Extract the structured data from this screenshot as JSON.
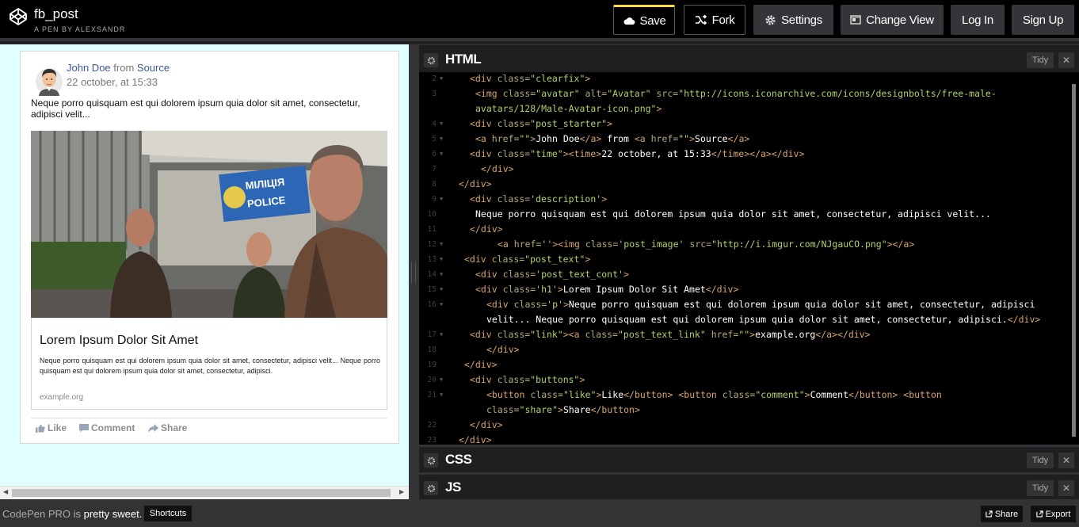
{
  "header": {
    "title": "fb_post",
    "subtitle": "A PEN BY ALEXSANDR",
    "save": "Save",
    "fork": "Fork",
    "settings": "Settings",
    "change_view": "Change View",
    "login": "Log In",
    "signup": "Sign Up",
    "accent_color": "#ffdd40"
  },
  "post": {
    "author": "John Doe",
    "from_text": "from",
    "source": "Source",
    "time": "22 october, at 15:33",
    "description": "Neque porro quisquam est qui dolorem ipsum quia dolor sit amet, consectetur, adipisci velit...",
    "image_sign_1": "МІЛІЦІЯ",
    "image_sign_2": "POLICE",
    "link_title": "Lorem Ipsum Dolor Sit Amet",
    "link_text": "Neque porro quisquam est qui dolorem ipsum quia dolor sit amet, consectetur, adipisci velit... Neque porro quisquam est qui dolorem ipsum quia dolor sit amet, consectetur, adipisci.",
    "link_url": "example.org",
    "like": "Like",
    "comment": "Comment",
    "share": "Share"
  },
  "panels": {
    "html": "HTML",
    "css": "CSS",
    "js": "JS",
    "tidy": "Tidy",
    "close": "✕"
  },
  "code_lines": [
    {
      "n": "2",
      "fold": true,
      "indent": 2,
      "parts": [
        [
          "t",
          "<div "
        ],
        [
          "a",
          "class="
        ],
        [
          "v",
          "\"clearfix\""
        ],
        [
          "t",
          ">"
        ]
      ]
    },
    {
      "n": "3",
      "fold": false,
      "indent": 3,
      "parts": [
        [
          "t",
          "<img "
        ],
        [
          "a",
          "class="
        ],
        [
          "v",
          "\"avatar\" "
        ],
        [
          "a",
          "alt="
        ],
        [
          "v",
          "\"Avatar\" "
        ],
        [
          "a",
          "src="
        ],
        [
          "v",
          "\"http://icons.iconarchive.com/icons/designbolts/free-male-"
        ]
      ]
    },
    {
      "n": "",
      "fold": false,
      "indent": 3,
      "parts": [
        [
          "v",
          "avatars/128/Male-Avatar-icon.png\""
        ],
        [
          "t",
          ">"
        ]
      ]
    },
    {
      "n": "4",
      "fold": true,
      "indent": 2,
      "parts": [
        [
          "t",
          "<div "
        ],
        [
          "a",
          "class="
        ],
        [
          "v",
          "\"post_starter\""
        ],
        [
          "t",
          ">"
        ]
      ]
    },
    {
      "n": "5",
      "fold": true,
      "indent": 3,
      "parts": [
        [
          "t",
          "<a "
        ],
        [
          "a",
          "href="
        ],
        [
          "v",
          "\"\""
        ],
        [
          "t",
          ">"
        ],
        [
          "w",
          "John Doe"
        ],
        [
          "t",
          "</a> "
        ],
        [
          "w",
          "from "
        ],
        [
          "t",
          "<a "
        ],
        [
          "a",
          "href="
        ],
        [
          "v",
          "\"\""
        ],
        [
          "t",
          ">"
        ],
        [
          "w",
          "Source"
        ],
        [
          "t",
          "</a>"
        ]
      ]
    },
    {
      "n": "6",
      "fold": true,
      "indent": 2,
      "parts": [
        [
          "t",
          "<div "
        ],
        [
          "a",
          "class="
        ],
        [
          "v",
          "\"time\""
        ],
        [
          "t",
          ">"
        ],
        [
          "t",
          "<time>"
        ],
        [
          "w",
          "22 october, at 15:33"
        ],
        [
          "t",
          "</time></a></div>"
        ]
      ]
    },
    {
      "n": "7",
      "fold": false,
      "indent": 4,
      "parts": [
        [
          "t",
          "</div>"
        ]
      ]
    },
    {
      "n": "8",
      "fold": false,
      "indent": 0,
      "parts": [
        [
          "t",
          "</div>"
        ]
      ]
    },
    {
      "n": "9",
      "fold": true,
      "indent": 2,
      "parts": [
        [
          "t",
          "<div "
        ],
        [
          "a",
          "class="
        ],
        [
          "v",
          "'description'"
        ],
        [
          "t",
          ">"
        ]
      ]
    },
    {
      "n": "10",
      "fold": false,
      "indent": 3,
      "parts": [
        [
          "w",
          "Neque porro quisquam est qui dolorem ipsum quia dolor sit amet, consectetur, adipisci velit..."
        ]
      ]
    },
    {
      "n": "11",
      "fold": false,
      "indent": 2,
      "parts": [
        [
          "t",
          "</div>"
        ]
      ]
    },
    {
      "n": "12",
      "fold": true,
      "indent": 7,
      "parts": [
        [
          "t",
          "<a "
        ],
        [
          "a",
          "href="
        ],
        [
          "v",
          "''"
        ],
        [
          "t",
          ">"
        ],
        [
          "t",
          "<img "
        ],
        [
          "a",
          "class="
        ],
        [
          "v",
          "'post_image' "
        ],
        [
          "a",
          "src="
        ],
        [
          "v",
          "\"http://i.imgur.com/NJgauCO.png\""
        ],
        [
          "t",
          "></a>"
        ]
      ]
    },
    {
      "n": "13",
      "fold": true,
      "indent": 1,
      "parts": [
        [
          "t",
          "<div "
        ],
        [
          "a",
          "class="
        ],
        [
          "v",
          "\"post_text\""
        ],
        [
          "t",
          ">"
        ]
      ]
    },
    {
      "n": "14",
      "fold": true,
      "indent": 3,
      "parts": [
        [
          "t",
          "<div "
        ],
        [
          "a",
          "class="
        ],
        [
          "v",
          "'post_text_cont'"
        ],
        [
          "t",
          ">"
        ]
      ]
    },
    {
      "n": "15",
      "fold": true,
      "indent": 3,
      "parts": [
        [
          "t",
          "<div "
        ],
        [
          "a",
          "class="
        ],
        [
          "v",
          "'h1'"
        ],
        [
          "t",
          ">"
        ],
        [
          "w",
          "Lorem Ipsum Dolor Sit Amet"
        ],
        [
          "t",
          "</div>"
        ]
      ]
    },
    {
      "n": "16",
      "fold": true,
      "indent": 5,
      "parts": [
        [
          "t",
          "<div "
        ],
        [
          "a",
          "class="
        ],
        [
          "v",
          "'p'"
        ],
        [
          "t",
          ">"
        ],
        [
          "w",
          "Neque porro quisquam est qui dolorem ipsum quia dolor sit amet, consectetur, adipisci"
        ]
      ]
    },
    {
      "n": "",
      "fold": false,
      "indent": 5,
      "parts": [
        [
          "w",
          "velit... Neque porro quisquam est qui dolorem ipsum quia dolor sit amet, consectetur, adipisci."
        ],
        [
          "t",
          "</div>"
        ]
      ]
    },
    {
      "n": "17",
      "fold": true,
      "indent": 2,
      "parts": [
        [
          "t",
          "<div "
        ],
        [
          "a",
          "class="
        ],
        [
          "v",
          "\"link\""
        ],
        [
          "t",
          ">"
        ],
        [
          "t",
          "<a "
        ],
        [
          "a",
          "class="
        ],
        [
          "v",
          "\"post_text_link\" "
        ],
        [
          "a",
          "href="
        ],
        [
          "v",
          "\"\""
        ],
        [
          "t",
          ">"
        ],
        [
          "w",
          "example.org"
        ],
        [
          "t",
          "</a></div>"
        ]
      ]
    },
    {
      "n": "18",
      "fold": false,
      "indent": 5,
      "parts": [
        [
          "t",
          "</div>"
        ]
      ]
    },
    {
      "n": "19",
      "fold": false,
      "indent": 1,
      "parts": [
        [
          "t",
          "</div>"
        ]
      ]
    },
    {
      "n": "20",
      "fold": true,
      "indent": 2,
      "parts": [
        [
          "t",
          "<div "
        ],
        [
          "a",
          "class="
        ],
        [
          "v",
          "\"buttons\""
        ],
        [
          "t",
          ">"
        ]
      ]
    },
    {
      "n": "21",
      "fold": true,
      "indent": 5,
      "parts": [
        [
          "t",
          "<button "
        ],
        [
          "a",
          "class="
        ],
        [
          "v",
          "\"like\""
        ],
        [
          "t",
          ">"
        ],
        [
          "w",
          "Like"
        ],
        [
          "t",
          "</button> "
        ],
        [
          "t",
          "<button "
        ],
        [
          "a",
          "class="
        ],
        [
          "v",
          "\"comment\""
        ],
        [
          "t",
          ">"
        ],
        [
          "w",
          "Comment"
        ],
        [
          "t",
          "</button> "
        ],
        [
          "t",
          "<button"
        ]
      ]
    },
    {
      "n": "",
      "fold": false,
      "indent": 5,
      "parts": [
        [
          "a",
          "class="
        ],
        [
          "v",
          "\"share\""
        ],
        [
          "t",
          ">"
        ],
        [
          "w",
          "Share"
        ],
        [
          "t",
          "</button>"
        ]
      ]
    },
    {
      "n": "22",
      "fold": false,
      "indent": 2,
      "parts": [
        [
          "t",
          "</div>"
        ]
      ]
    },
    {
      "n": "23",
      "fold": false,
      "indent": 0,
      "parts": [
        [
          "t",
          "</div>"
        ]
      ]
    }
  ],
  "footer": {
    "promo_prefix": "CodePen PRO is",
    "promo_bold": "pretty sweet.",
    "shortcuts": "Shortcuts",
    "share": "Share",
    "export": "Export"
  }
}
